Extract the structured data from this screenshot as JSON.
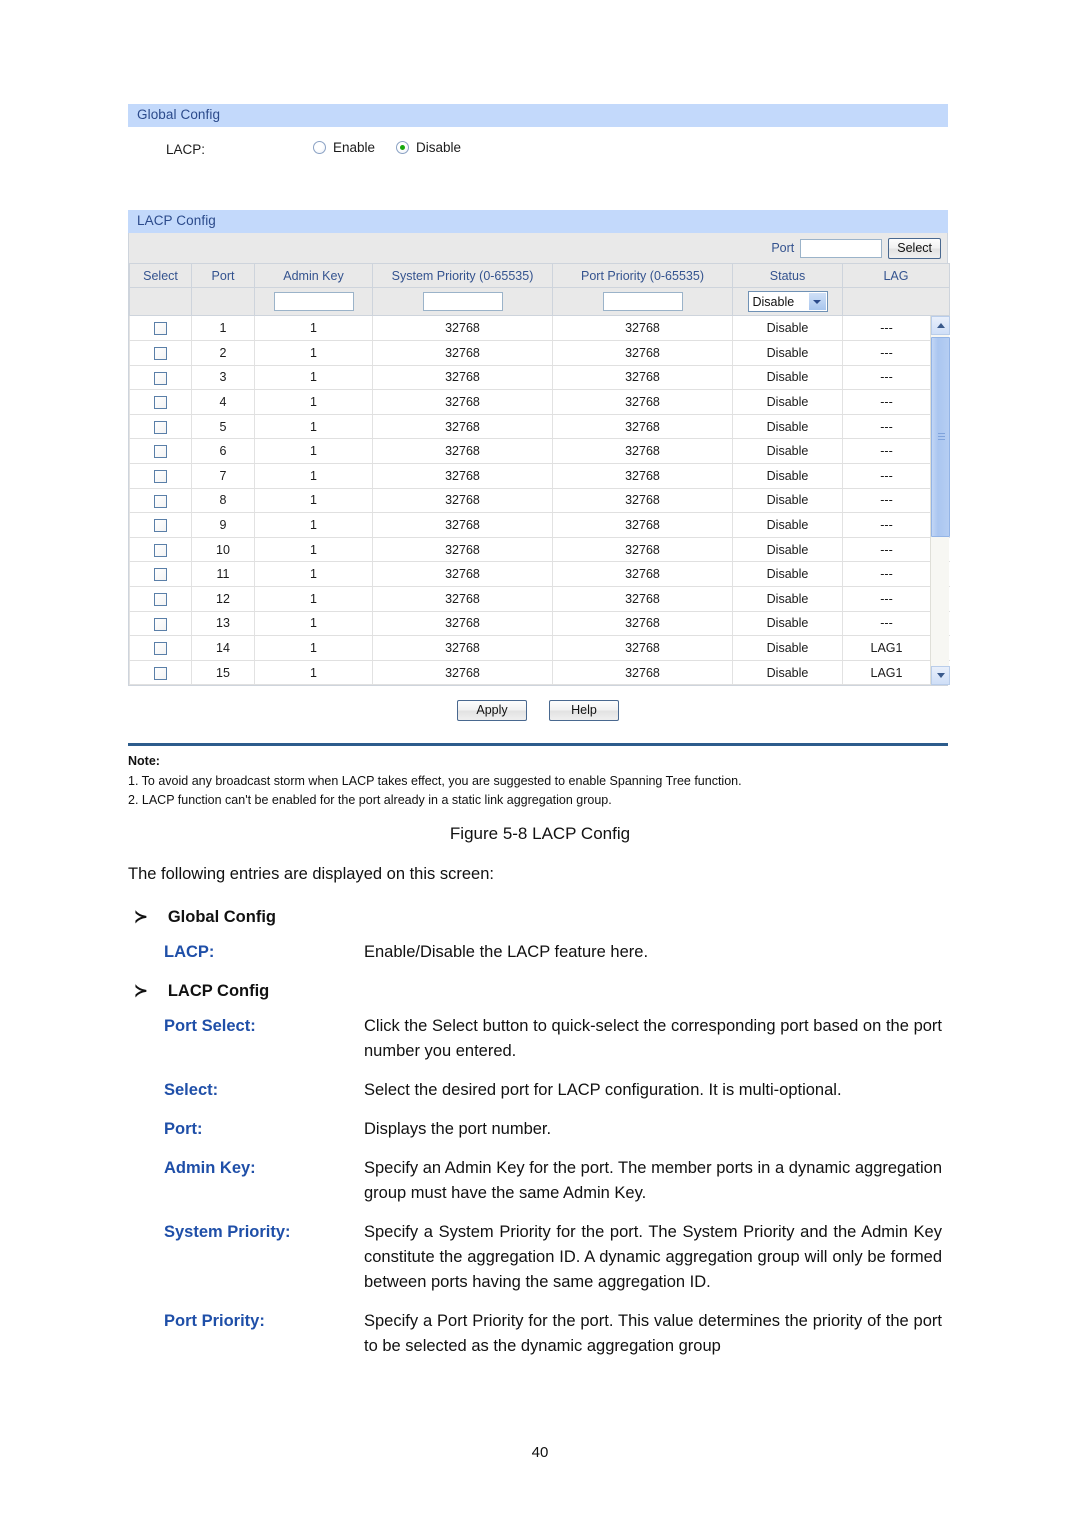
{
  "global_config": {
    "panel_title": "Global Config",
    "lacp_label": "LACP:",
    "enable_label": "Enable",
    "disable_label": "Disable",
    "selected": "Disable"
  },
  "lacp_config": {
    "panel_title": "LACP Config",
    "port_filter_label": "Port",
    "port_filter_value": "",
    "select_button": "Select",
    "columns": [
      "Select",
      "Port",
      "Admin Key",
      "System Priority (0-65535)",
      "Port Priority (0-65535)",
      "Status",
      "LAG"
    ],
    "input_row": {
      "admin_key": "",
      "system_priority": "",
      "port_priority": "",
      "status": "Disable"
    },
    "rows": [
      {
        "port": "1",
        "admin_key": "1",
        "system_priority": "32768",
        "port_priority": "32768",
        "status": "Disable",
        "lag": "---"
      },
      {
        "port": "2",
        "admin_key": "1",
        "system_priority": "32768",
        "port_priority": "32768",
        "status": "Disable",
        "lag": "---"
      },
      {
        "port": "3",
        "admin_key": "1",
        "system_priority": "32768",
        "port_priority": "32768",
        "status": "Disable",
        "lag": "---"
      },
      {
        "port": "4",
        "admin_key": "1",
        "system_priority": "32768",
        "port_priority": "32768",
        "status": "Disable",
        "lag": "---"
      },
      {
        "port": "5",
        "admin_key": "1",
        "system_priority": "32768",
        "port_priority": "32768",
        "status": "Disable",
        "lag": "---"
      },
      {
        "port": "6",
        "admin_key": "1",
        "system_priority": "32768",
        "port_priority": "32768",
        "status": "Disable",
        "lag": "---"
      },
      {
        "port": "7",
        "admin_key": "1",
        "system_priority": "32768",
        "port_priority": "32768",
        "status": "Disable",
        "lag": "---"
      },
      {
        "port": "8",
        "admin_key": "1",
        "system_priority": "32768",
        "port_priority": "32768",
        "status": "Disable",
        "lag": "---"
      },
      {
        "port": "9",
        "admin_key": "1",
        "system_priority": "32768",
        "port_priority": "32768",
        "status": "Disable",
        "lag": "---"
      },
      {
        "port": "10",
        "admin_key": "1",
        "system_priority": "32768",
        "port_priority": "32768",
        "status": "Disable",
        "lag": "---"
      },
      {
        "port": "11",
        "admin_key": "1",
        "system_priority": "32768",
        "port_priority": "32768",
        "status": "Disable",
        "lag": "---"
      },
      {
        "port": "12",
        "admin_key": "1",
        "system_priority": "32768",
        "port_priority": "32768",
        "status": "Disable",
        "lag": "---"
      },
      {
        "port": "13",
        "admin_key": "1",
        "system_priority": "32768",
        "port_priority": "32768",
        "status": "Disable",
        "lag": "---"
      },
      {
        "port": "14",
        "admin_key": "1",
        "system_priority": "32768",
        "port_priority": "32768",
        "status": "Disable",
        "lag": "LAG1"
      },
      {
        "port": "15",
        "admin_key": "1",
        "system_priority": "32768",
        "port_priority": "32768",
        "status": "Disable",
        "lag": "LAG1"
      }
    ],
    "apply_button": "Apply",
    "help_button": "Help"
  },
  "note": {
    "title": "Note:",
    "items": [
      "1. To avoid any broadcast storm when LACP takes effect, you are suggested to enable Spanning Tree function.",
      "2. LACP function can't be enabled for the port already in a static link aggregation group."
    ]
  },
  "figure_caption": "Figure 5-8 LACP Config",
  "document": {
    "intro": "The following entries are displayed on this screen:",
    "arrow": "≻",
    "sections": [
      {
        "heading": "Global Config",
        "entries": [
          {
            "term": "LACP:",
            "desc": "Enable/Disable the LACP feature here."
          }
        ]
      },
      {
        "heading": "LACP Config",
        "entries": [
          {
            "term": "Port Select:",
            "desc": "Click the Select button to quick-select the corresponding port based on the port number you entered."
          },
          {
            "term": "Select:",
            "desc": "Select the desired port for LACP configuration. It is multi-optional."
          },
          {
            "term": "Port:",
            "desc": "Displays the port number."
          },
          {
            "term": "Admin Key:",
            "desc": "Specify an Admin Key for the port. The member ports in a dynamic aggregation group must have the same Admin Key."
          },
          {
            "term": "System Priority:",
            "desc": "Specify a System Priority for the port. The System Priority and the Admin Key constitute the aggregation ID. A dynamic aggregation group will only be formed between ports having the same aggregation ID."
          },
          {
            "term": "Port Priority:",
            "desc": "Specify a Port Priority for the port. This value determines the priority of the port to be selected as the dynamic aggregation group"
          }
        ]
      }
    ]
  },
  "page_number": "40",
  "colors": {
    "panel_header_bg": "#c3d9fb",
    "panel_header_text": "#2b4a8b",
    "grid_header_bg": "#e9e9e9",
    "grid_header_text": "#34538f",
    "radio_selected": "#17a80d",
    "note_rule": "#2d5c8c",
    "term_blue": "#1f4fa8"
  }
}
